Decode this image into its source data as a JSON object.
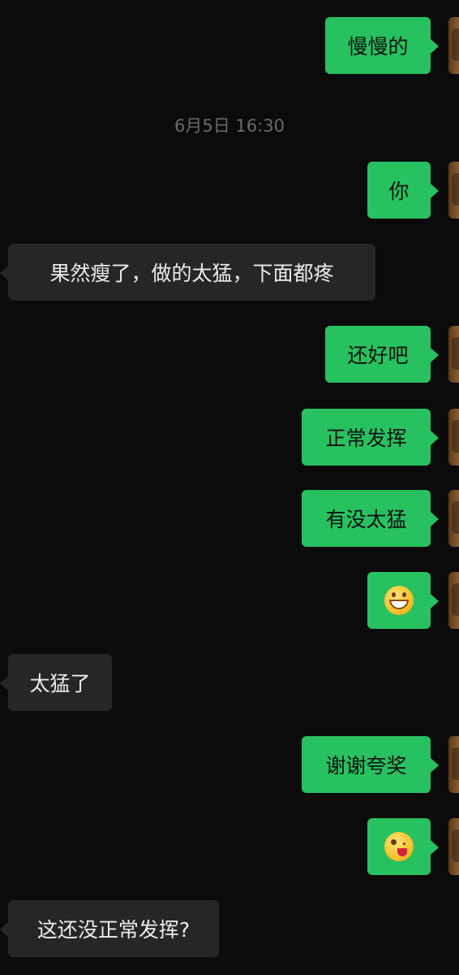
{
  "timestamp": "6月5日 16:30",
  "messages": [
    {
      "side": "out",
      "text": "慢慢的"
    },
    {
      "side": "out",
      "text": "你"
    },
    {
      "side": "in",
      "text": "果然瘦了，做的太猛，下面都疼"
    },
    {
      "side": "out",
      "text": "还好吧"
    },
    {
      "side": "out",
      "text": "正常发挥"
    },
    {
      "side": "out",
      "text": "有没太猛"
    },
    {
      "side": "out",
      "emoji": "grinning-face-emoji"
    },
    {
      "side": "in",
      "text": "太猛了"
    },
    {
      "side": "out",
      "text": "谢谢夸奖"
    },
    {
      "side": "out",
      "emoji": "winking-face-tongue-emoji"
    },
    {
      "side": "in",
      "text": "这还没正常发挥?"
    }
  ],
  "colors": {
    "background": "#0b0b0b",
    "outgoing_bubble": "#28c160",
    "incoming_bubble": "#262626",
    "timestamp_text": "#6a6a6a"
  }
}
